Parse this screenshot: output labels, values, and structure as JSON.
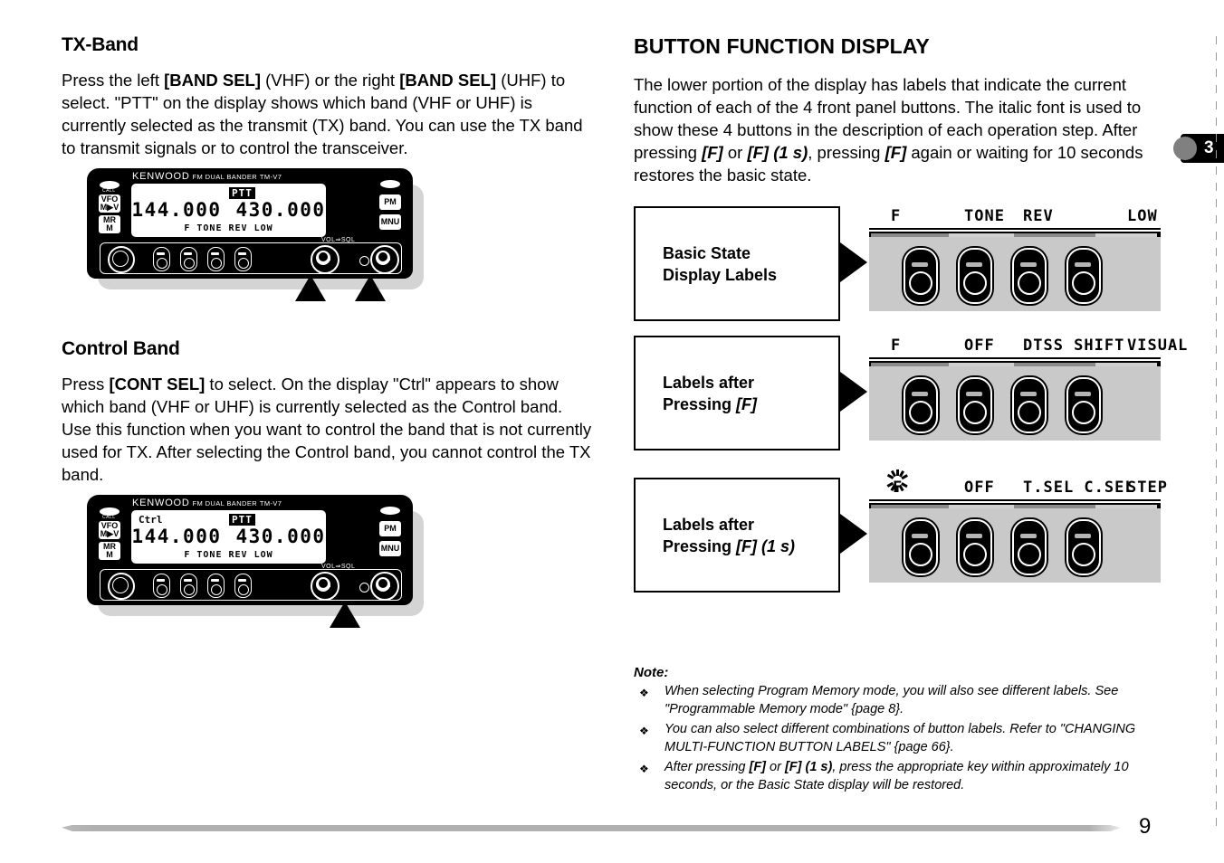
{
  "left_column": {
    "section1": {
      "heading": "TX-Band",
      "body_parts": [
        {
          "t": "Press the left ",
          "s": "n"
        },
        {
          "t": "[BAND SEL]",
          "s": "b"
        },
        {
          "t": " (VHF) or the right ",
          "s": "n"
        },
        {
          "t": "[BAND SEL]",
          "s": "b"
        },
        {
          "t": " (UHF) to select.  \"PTT\" on the display shows which band (VHF or UHF) is currently selected as the transmit (TX) band.  You can use the TX band to transmit signals or to control the transceiver.",
          "s": "n"
        }
      ]
    },
    "section2": {
      "heading": "Control Band",
      "body_parts": [
        {
          "t": "Press ",
          "s": "n"
        },
        {
          "t": "[CONT SEL]",
          "s": "b"
        },
        {
          "t": " to select.  On the display \"Ctrl\" appears to show which band (VHF or UHF) is currently selected as the Control band.  Use this function when you want to control the band that is not currently used for TX.  After selecting the Control band, you cannot control the TX band.",
          "s": "n"
        }
      ]
    }
  },
  "radio": {
    "brand_name": "KENWOOD",
    "brand_type": "FM DUAL BANDER",
    "brand_model": "TM-V7",
    "side_buttons": {
      "call": "CALL",
      "vfo": "VFO",
      "vfo_sub": "M▶V",
      "mr": "MR",
      "mr_sub": "M",
      "pm": "PM",
      "mnu": "MNU"
    },
    "panel_labels": {
      "volsql": "VOL⇒SQL"
    },
    "display_1": {
      "ctrl": "",
      "ptt": "PTT",
      "freq_left": "144.000",
      "freq_right": "430.000",
      "function_labels": "F  TONE REV LOW"
    },
    "display_2": {
      "ctrl": "Ctrl",
      "ptt": "PTT",
      "freq_left": "144.000",
      "freq_right": "430.000",
      "function_labels": "F  TONE REV LOW"
    }
  },
  "right_column": {
    "heading": "BUTTON FUNCTION DISPLAY",
    "intro_parts": [
      {
        "t": "The lower portion of the display has labels that indicate the current function of each of the 4 front panel buttons.  The italic font is used to show these 4 buttons in the description of each operation step.  After pressing ",
        "s": "n"
      },
      {
        "t": "[F]",
        "s": "bi"
      },
      {
        "t": " or ",
        "s": "n"
      },
      {
        "t": "[F] (1 s)",
        "s": "bi"
      },
      {
        "t": ", pressing ",
        "s": "n"
      },
      {
        "t": "[F]",
        "s": "bi"
      },
      {
        "t": " again or waiting for 10 seconds restores the basic state.",
        "s": "n"
      }
    ],
    "flows": [
      {
        "box_line1": "Basic State",
        "box_line2": "Display Labels",
        "box_italic": "",
        "blinking": false,
        "segments": [
          "F",
          "TONE",
          "REV",
          "LOW"
        ]
      },
      {
        "box_line1": "Labels after",
        "box_line2": "Pressing ",
        "box_italic": "[F]",
        "blinking": false,
        "segments": [
          "F",
          "OFF",
          "DTSS SHIFT",
          "VISUAL"
        ]
      },
      {
        "box_line1": "Labels after",
        "box_line2": "Pressing ",
        "box_italic": "[F] (1 s)",
        "blinking": true,
        "segments": [
          "F",
          "OFF",
          "T.SEL C.SEL",
          "STEP"
        ]
      }
    ]
  },
  "note": {
    "heading": "Note:",
    "bullet_char": "❖",
    "items": [
      [
        {
          "t": "When selecting Program Memory mode, you will also see different labels.  See \"Programmable Memory mode\" {page 8}.",
          "s": "n"
        }
      ],
      [
        {
          "t": "You can also select different combinations of button labels.  Refer to \"CHANGING MULTI-FUNCTION BUTTON LABELS\" {page 66}.",
          "s": "n"
        }
      ],
      [
        {
          "t": "After pressing ",
          "s": "n"
        },
        {
          "t": "[F]",
          "s": "b"
        },
        {
          "t": " or ",
          "s": "n"
        },
        {
          "t": "[F] (1 s)",
          "s": "b"
        },
        {
          "t": ", press the appropriate key within approximately 10 seconds, or the Basic State display will be restored.",
          "s": "n"
        }
      ]
    ]
  },
  "page": {
    "chapter_tab": "3",
    "page_number": "9"
  }
}
